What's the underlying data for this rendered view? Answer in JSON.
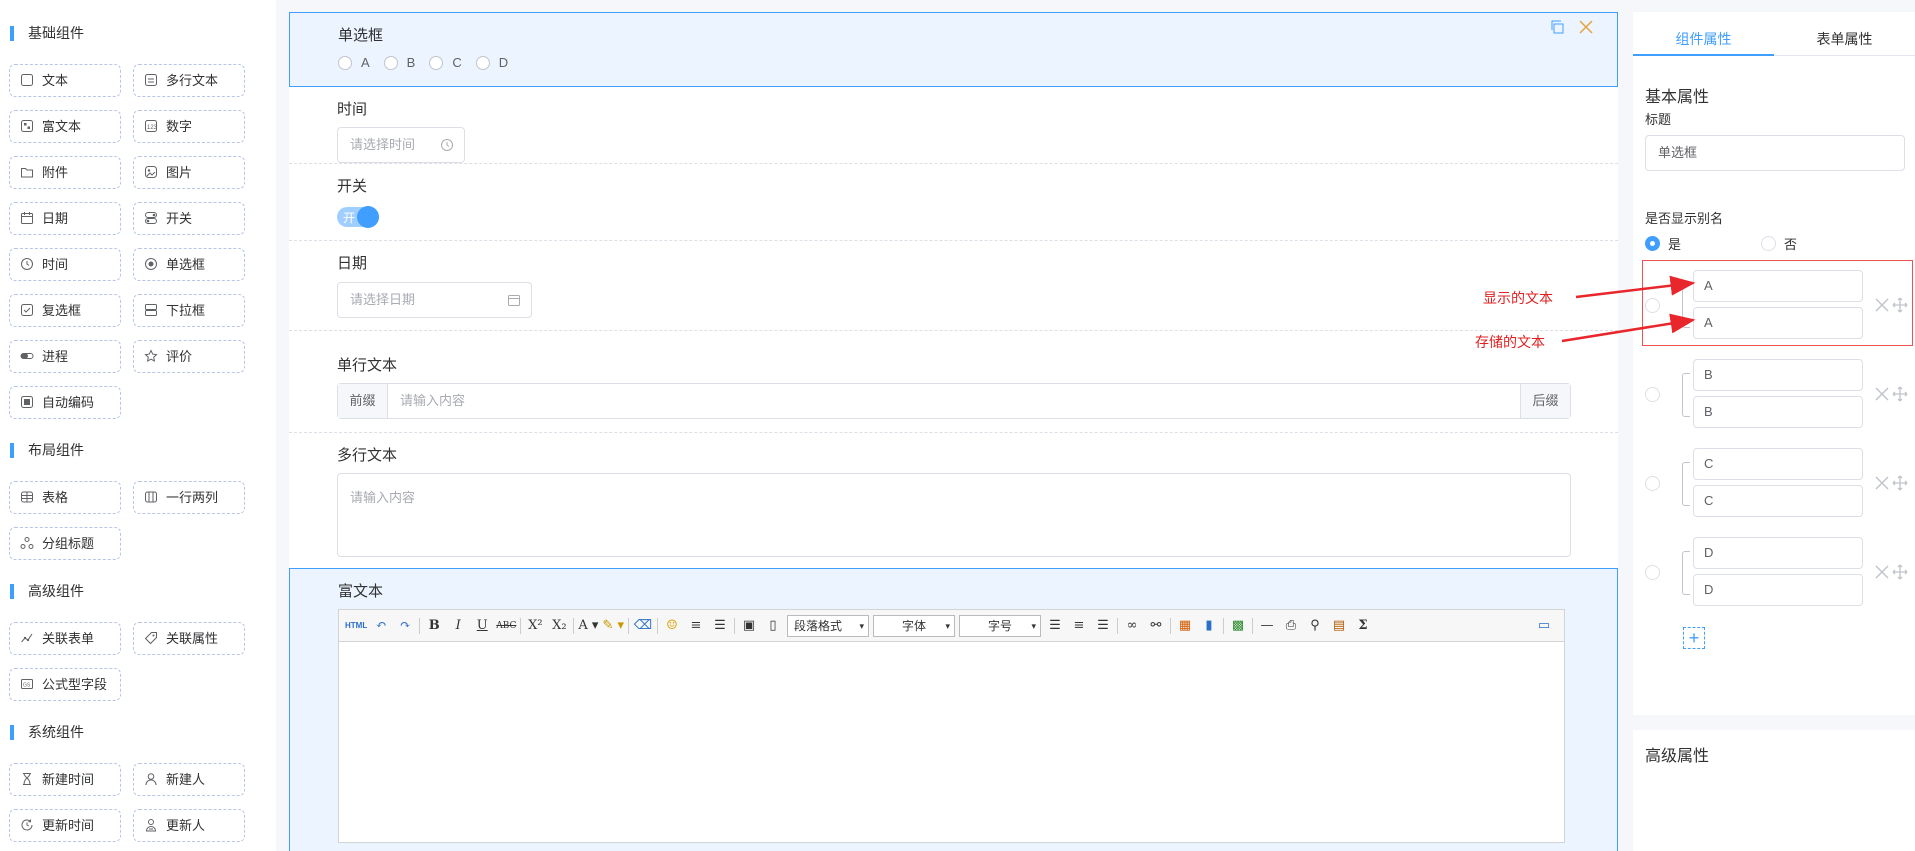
{
  "palette": {
    "groups": [
      {
        "title": "基础组件",
        "items": [
          {
            "label": "文本",
            "icon": "text-icon"
          },
          {
            "label": "多行文本",
            "icon": "textarea-icon"
          },
          {
            "label": "富文本",
            "icon": "rich-text-icon"
          },
          {
            "label": "数字",
            "icon": "number-icon"
          },
          {
            "label": "附件",
            "icon": "folder-icon"
          },
          {
            "label": "图片",
            "icon": "image-icon"
          },
          {
            "label": "日期",
            "icon": "calendar-icon"
          },
          {
            "label": "开关",
            "icon": "switch-icon"
          },
          {
            "label": "时间",
            "icon": "clock-icon"
          },
          {
            "label": "单选框",
            "icon": "radio-icon"
          },
          {
            "label": "复选框",
            "icon": "checkbox-icon"
          },
          {
            "label": "下拉框",
            "icon": "select-icon"
          },
          {
            "label": "进程",
            "icon": "progress-icon"
          },
          {
            "label": "评价",
            "icon": "star-icon"
          },
          {
            "label": "自动编码",
            "icon": "autocode-icon"
          }
        ]
      },
      {
        "title": "布局组件",
        "items": [
          {
            "label": "表格",
            "icon": "table-icon"
          },
          {
            "label": "一行两列",
            "icon": "columns-icon"
          },
          {
            "label": "分组标题",
            "icon": "group-icon"
          }
        ]
      },
      {
        "title": "高级组件",
        "items": [
          {
            "label": "关联表单",
            "icon": "link-form-icon"
          },
          {
            "label": "关联属性",
            "icon": "tag-icon"
          },
          {
            "label": "公式型字段",
            "icon": "formula-icon"
          }
        ]
      },
      {
        "title": "系统组件",
        "items": [
          {
            "label": "新建时间",
            "icon": "hourglass-icon"
          },
          {
            "label": "新建人",
            "icon": "user-icon"
          },
          {
            "label": "更新时间",
            "icon": "refresh-time-icon"
          },
          {
            "label": "更新人",
            "icon": "user-update-icon"
          }
        ]
      }
    ]
  },
  "canvas": {
    "radio": {
      "label": "单选框",
      "options": [
        "A",
        "B",
        "C",
        "D"
      ]
    },
    "time": {
      "label": "时间",
      "placeholder": "请选择时间"
    },
    "switch": {
      "label": "开关",
      "on_text": "开"
    },
    "date": {
      "label": "日期",
      "placeholder": "请选择日期"
    },
    "single_text": {
      "label": "单行文本",
      "prefix": "前缀",
      "placeholder": "请输入内容",
      "suffix": "后缀"
    },
    "multi_text": {
      "label": "多行文本",
      "placeholder": "请输入内容"
    },
    "rich_text": {
      "label": "富文本",
      "paragraph": "段落格式",
      "font": "字体",
      "size": "字号"
    }
  },
  "props": {
    "tabs": [
      "组件属性",
      "表单属性"
    ],
    "basic_title": "基本属性",
    "title_label": "标题",
    "title_value": "单选框",
    "alias_label": "是否显示别名",
    "alias_yes": "是",
    "alias_no": "否",
    "options": [
      {
        "display": "A",
        "stored": "A"
      },
      {
        "display": "B",
        "stored": "B"
      },
      {
        "display": "C",
        "stored": "C"
      },
      {
        "display": "D",
        "stored": "D"
      }
    ],
    "advanced_title": "高级属性"
  },
  "annotations": {
    "display_text": "显示的文本",
    "stored_text": "存储的文本"
  },
  "colors": {
    "primary": "#409eff",
    "annotation": "#e02020",
    "border": "#dcdfe6"
  }
}
